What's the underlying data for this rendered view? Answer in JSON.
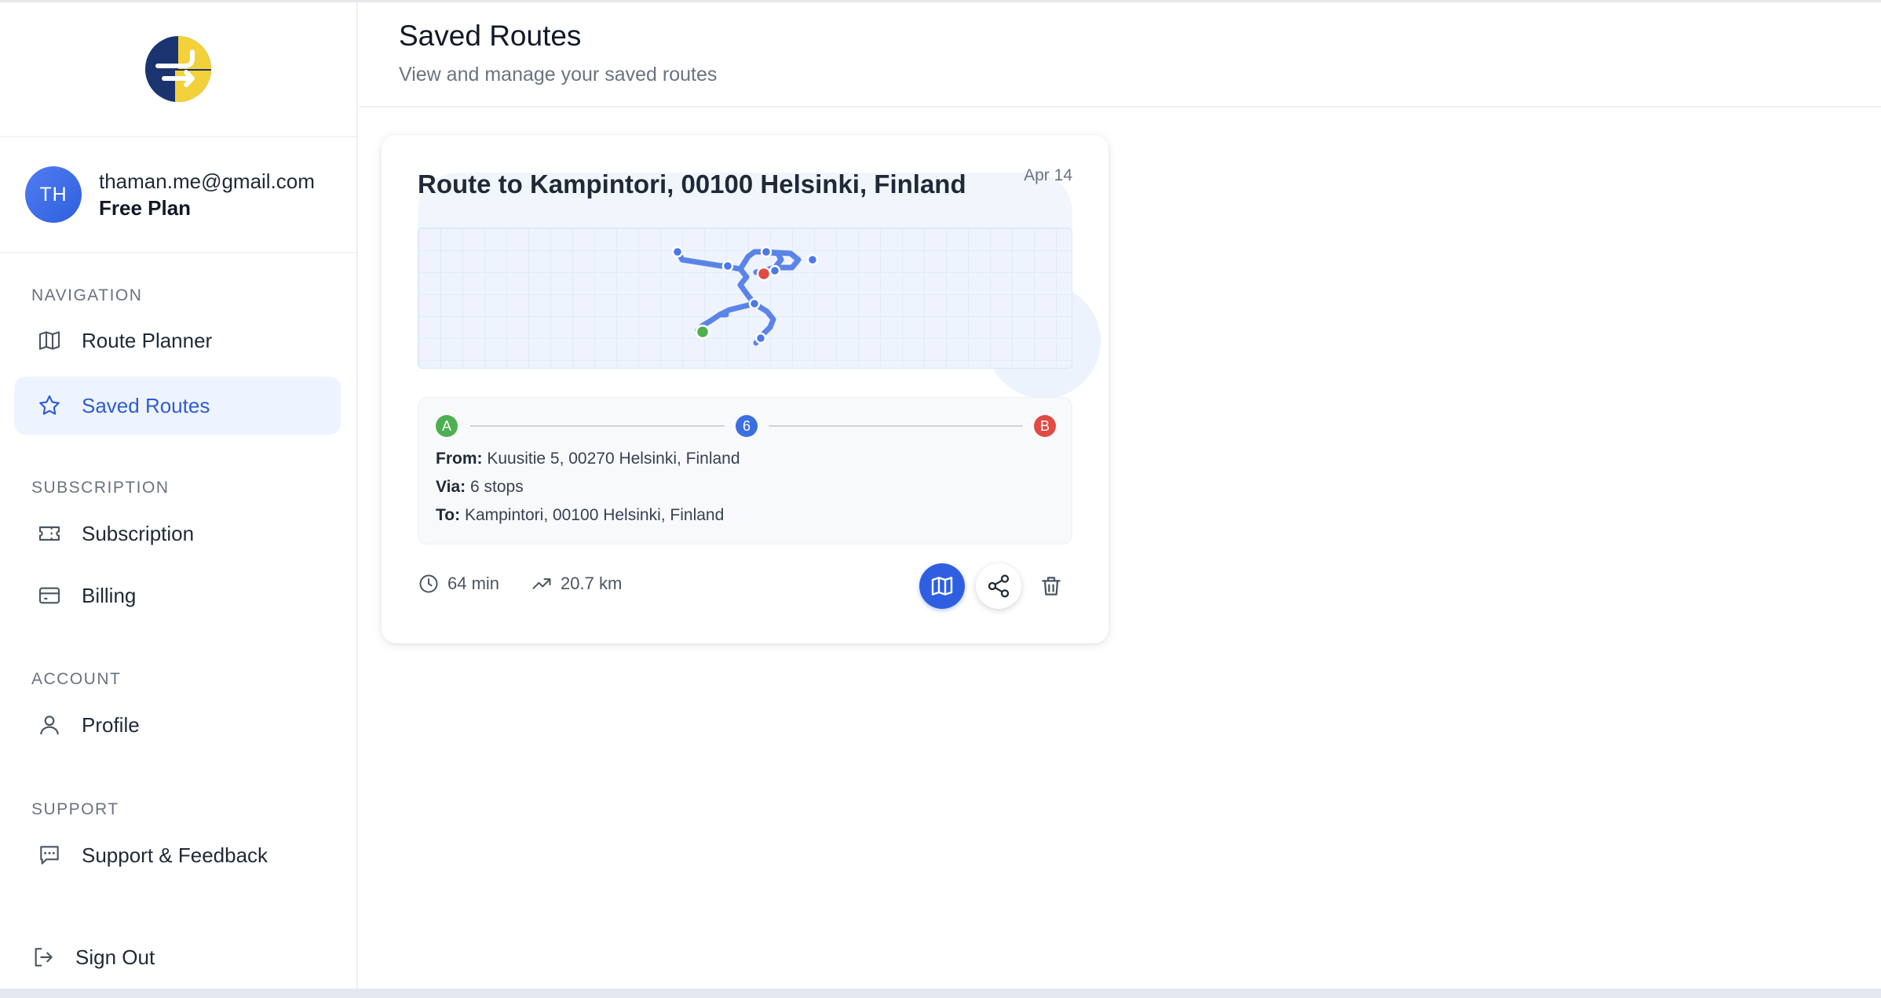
{
  "colors": {
    "accent": "#2f5fe0",
    "active_bg": "#eef4ff",
    "start_marker": "#4caf50",
    "end_marker": "#e04b43",
    "via_marker": "#3b6fe0"
  },
  "sidebar": {
    "logo_icon": "app-logo",
    "user": {
      "initials": "TH",
      "email": "thaman.me@gmail.com",
      "plan": "Free Plan"
    },
    "sections": {
      "navigation": "NAVIGATION",
      "subscription": "SUBSCRIPTION",
      "account": "ACCOUNT",
      "support": "SUPPORT"
    },
    "items": {
      "route_planner": {
        "label": "Route Planner",
        "icon": "map-icon"
      },
      "saved_routes": {
        "label": "Saved Routes",
        "icon": "star-icon",
        "active": true
      },
      "subscription": {
        "label": "Subscription",
        "icon": "ticket-icon"
      },
      "billing": {
        "label": "Billing",
        "icon": "credit-card-icon"
      },
      "profile": {
        "label": "Profile",
        "icon": "user-icon"
      },
      "support": {
        "label": "Support & Feedback",
        "icon": "message-icon"
      },
      "sign_out": {
        "label": "Sign Out",
        "icon": "sign-out-icon"
      }
    }
  },
  "header": {
    "title": "Saved Routes",
    "subtitle": "View and manage your saved routes"
  },
  "routes": [
    {
      "title": "Route to Kampintori, 00100 Helsinki, Finland",
      "date": "Apr 14",
      "markers": {
        "start": "A",
        "via": "6",
        "end": "B"
      },
      "from_label": "From:",
      "from": "Kuusitie 5, 00270 Helsinki, Finland",
      "via_label": "Via:",
      "via": "6 stops",
      "to_label": "To:",
      "to": "Kampintori, 00100 Helsinki, Finland",
      "duration": "64 min",
      "distance": "20.7 km",
      "actions": [
        "map-icon",
        "share-icon",
        "trash-icon"
      ]
    }
  ]
}
